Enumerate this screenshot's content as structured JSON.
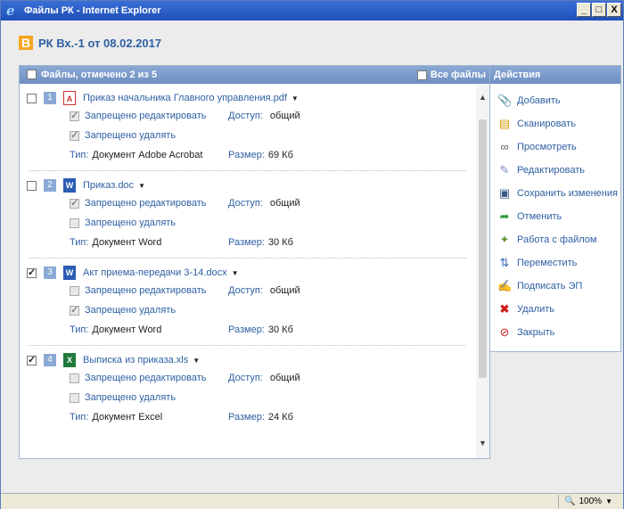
{
  "window": {
    "title": "Файлы РК - Internet Explorer",
    "icon": "ie-icon",
    "controls": [
      "_",
      "□",
      "X"
    ]
  },
  "header": {
    "badge": "B",
    "title": "РК Вх.-1 от 08.02.2017"
  },
  "files_panel": {
    "heading": "Файлы, отмечено 2 из 5",
    "all_files": "Все файлы",
    "labels": {
      "edit": "Запрещено редактировать",
      "delete": "Запрещено удалять",
      "access": "Доступ:",
      "type": "Тип:",
      "size": "Размер:"
    },
    "files": [
      {
        "num": "1",
        "checked": false,
        "icon": "pdf-icon",
        "name": "Приказ начальника Главного управления.pdf",
        "no_edit": true,
        "no_delete": true,
        "access": "общий",
        "type": "Документ Adobe Acrobat",
        "size": "69 Кб"
      },
      {
        "num": "2",
        "checked": false,
        "icon": "word-icon",
        "name": "Приказ.doc",
        "no_edit": true,
        "no_delete": false,
        "access": "общий",
        "type": "Документ Word",
        "size": "30 Кб"
      },
      {
        "num": "3",
        "checked": true,
        "icon": "word-icon",
        "name": "Акт приема-передачи 3-14.docx",
        "no_edit": false,
        "no_delete": true,
        "access": "общий",
        "type": "Документ Word",
        "size": "30 Кб"
      },
      {
        "num": "4",
        "checked": true,
        "icon": "excel-icon",
        "name": "Выписка из приказа.xls",
        "no_edit": false,
        "no_delete": false,
        "access": "общий",
        "type": "Документ Excel",
        "size": "24 Кб"
      }
    ]
  },
  "actions": {
    "heading": "Действия",
    "items": [
      {
        "label": "Добавить",
        "icon": "add-clip-icon"
      },
      {
        "label": "Сканировать",
        "icon": "scanner-icon"
      },
      {
        "label": "Просмотреть",
        "icon": "glasses-icon"
      },
      {
        "label": "Редактировать",
        "icon": "pencil-icon"
      },
      {
        "label": "Сохранить изменения",
        "icon": "save-icon"
      },
      {
        "label": "Отменить",
        "icon": "undo-arrow-icon"
      },
      {
        "label": "Работа с файлом",
        "icon": "file-tools-icon"
      },
      {
        "label": "Переместить",
        "icon": "move-list-icon"
      },
      {
        "label": "Подписать ЭП",
        "icon": "sign-icon"
      },
      {
        "label": "Удалить",
        "icon": "delete-x-icon"
      },
      {
        "label": "Закрыть",
        "icon": "close-circle-icon"
      }
    ]
  },
  "statusbar": {
    "zoom": "100%"
  },
  "colors": {
    "titlebar": "#1f4fb8",
    "panel_header": "#7f9dcb",
    "link": "#2e5fa3",
    "badge": "#f5a623"
  }
}
